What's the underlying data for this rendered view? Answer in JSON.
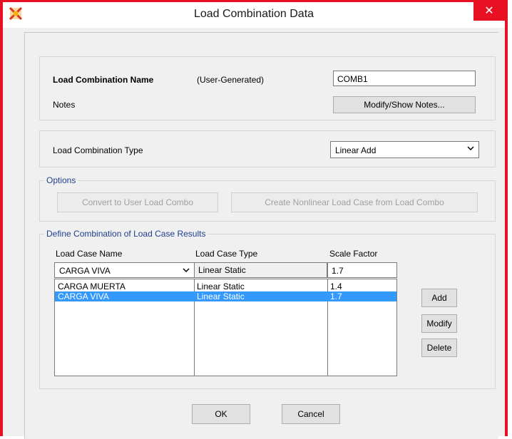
{
  "window": {
    "title": "Load Combination Data",
    "close_glyph": "✕"
  },
  "name_panel": {
    "name_label": "Load Combination Name",
    "name_source": "(User-Generated)",
    "name_value": "COMB1",
    "notes_label": "Notes",
    "notes_button": "Modify/Show Notes..."
  },
  "type_panel": {
    "label": "Load Combination Type",
    "selected": "Linear Add"
  },
  "options": {
    "legend": "Options",
    "convert_button": "Convert to User Load Combo",
    "create_button": "Create Nonlinear Load Case from Load Combo"
  },
  "define": {
    "legend": "Define Combination of Load Case Results",
    "headers": {
      "name": "Load Case Name",
      "type": "Load Case Type",
      "factor": "Scale Factor"
    },
    "editor": {
      "name": "CARGA VIVA",
      "type": "Linear Static",
      "factor": "1.7"
    },
    "rows": [
      {
        "name": "CARGA MUERTA",
        "type": "Linear Static",
        "factor": "1.4",
        "selected": false
      },
      {
        "name": "CARGA VIVA",
        "type": "Linear Static",
        "factor": "1.7",
        "selected": true
      }
    ],
    "add_button": "Add",
    "modify_button": "Modify",
    "delete_button": "Delete"
  },
  "footer": {
    "ok_button": "OK",
    "cancel_button": "Cancel"
  },
  "colors": {
    "accent_border": "#e81123",
    "selection": "#3399ff",
    "group_legend": "#1f3f8f"
  },
  "icons": {
    "app": "sap2000-logo-icon",
    "close": "close-icon",
    "dropdown": "chevron-down-icon"
  }
}
